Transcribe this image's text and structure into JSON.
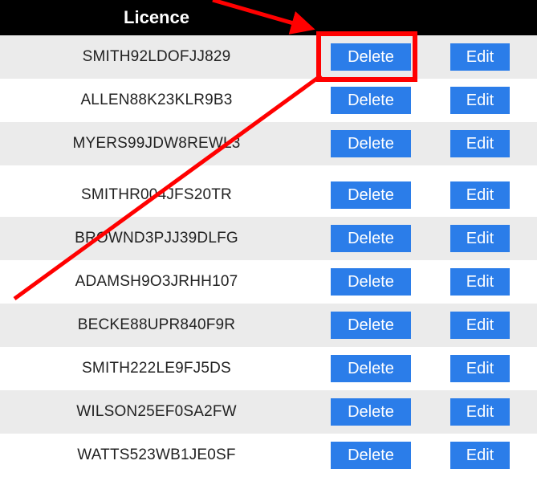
{
  "table": {
    "header": "Licence",
    "rows": [
      {
        "licence": "SMITH92LDOFJJ829",
        "delete_label": "Delete",
        "edit_label": "Edit"
      },
      {
        "licence": "ALLEN88K23KLR9B3",
        "delete_label": "Delete",
        "edit_label": "Edit"
      },
      {
        "licence": "MYERS99JDW8REWL3",
        "delete_label": "Delete",
        "edit_label": "Edit"
      },
      {
        "licence": "SMITHR004JFS20TR",
        "delete_label": "Delete",
        "edit_label": "Edit"
      },
      {
        "licence": "BROWND3PJJ39DLFG",
        "delete_label": "Delete",
        "edit_label": "Edit"
      },
      {
        "licence": "ADAMSH9O3JRHH107",
        "delete_label": "Delete",
        "edit_label": "Edit"
      },
      {
        "licence": "BECKE88UPR840F9R",
        "delete_label": "Delete",
        "edit_label": "Edit"
      },
      {
        "licence": "SMITH222LE9FJ5DS",
        "delete_label": "Delete",
        "edit_label": "Edit"
      },
      {
        "licence": "WILSON25EF0SA2FW",
        "delete_label": "Delete",
        "edit_label": "Edit"
      },
      {
        "licence": "WATTS523WB1JE0SF",
        "delete_label": "Delete",
        "edit_label": "Edit"
      }
    ]
  },
  "colors": {
    "header_bg": "#000000",
    "button_bg": "#2b7de9",
    "row_shaded": "#ebebeb",
    "annotation": "#ff0000"
  }
}
